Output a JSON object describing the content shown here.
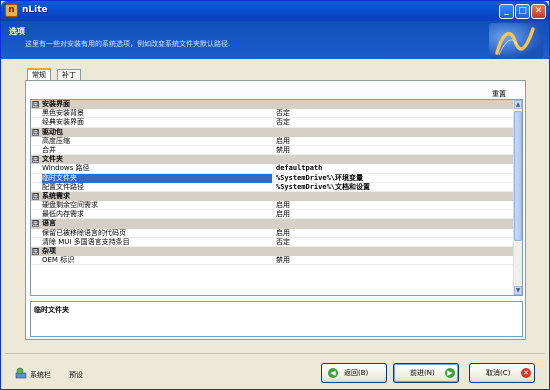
{
  "window": {
    "title": "nLite",
    "minimize": "_",
    "maximize": "□",
    "close": "✕"
  },
  "header": {
    "title": "选项",
    "subtitle": "这里有一些对安装有用的系统选项，例如改变系统文件夹默认路径.",
    "logo_icon": "nlite-logo-icon"
  },
  "tabs": [
    {
      "label": "常规",
      "active": true
    },
    {
      "label": "补丁",
      "active": false
    }
  ],
  "grid": {
    "reset_label": "重置",
    "rows": [
      {
        "type": "cat",
        "toggle": "⊟",
        "label": "安装界面"
      },
      {
        "type": "item",
        "name": "黑色安装背景",
        "value": "否定"
      },
      {
        "type": "item",
        "name": "经典安装界面",
        "value": "否定"
      },
      {
        "type": "cat",
        "toggle": "⊟",
        "label": "驱动包"
      },
      {
        "type": "item",
        "name": "高度压缩",
        "value": "启用"
      },
      {
        "type": "item",
        "name": "合并",
        "value": "禁用"
      },
      {
        "type": "cat",
        "toggle": "⊟",
        "label": "文件夹"
      },
      {
        "type": "item",
        "name": "Windows 路径",
        "value": "defaultpath",
        "bold": true
      },
      {
        "type": "item",
        "name": "临时文件夹",
        "value": "%SystemDrive%\\环境变量",
        "bold": true,
        "selected": true
      },
      {
        "type": "item",
        "name": "配置文件路径",
        "value": "%SystemDrive%\\文档和设置",
        "bold": true
      },
      {
        "type": "cat",
        "toggle": "⊟",
        "label": "系统需求"
      },
      {
        "type": "item",
        "name": "硬盘剩余空间需求",
        "value": "启用"
      },
      {
        "type": "item",
        "name": "最低内存需求",
        "value": "启用"
      },
      {
        "type": "cat",
        "toggle": "⊟",
        "label": "语言"
      },
      {
        "type": "item",
        "name": "保留已被移除语言的代码页",
        "value": "启用"
      },
      {
        "type": "item",
        "name": "清除 MUI 多国语言支持条目",
        "value": "否定"
      },
      {
        "type": "cat",
        "toggle": "⊟",
        "label": "杂项"
      },
      {
        "type": "item",
        "name": "OEM 标识",
        "value": "禁用"
      }
    ]
  },
  "description": {
    "title": "临时文件夹"
  },
  "footer": {
    "system_label": "系统栏",
    "preset_label": "预设",
    "back_label": "返回(B)",
    "next_label": "前进(N)",
    "cancel_label": "取消(C)"
  },
  "colors": {
    "accent": "#316ac5",
    "titlebar": "#0a46c6",
    "header": "#1555c0"
  }
}
